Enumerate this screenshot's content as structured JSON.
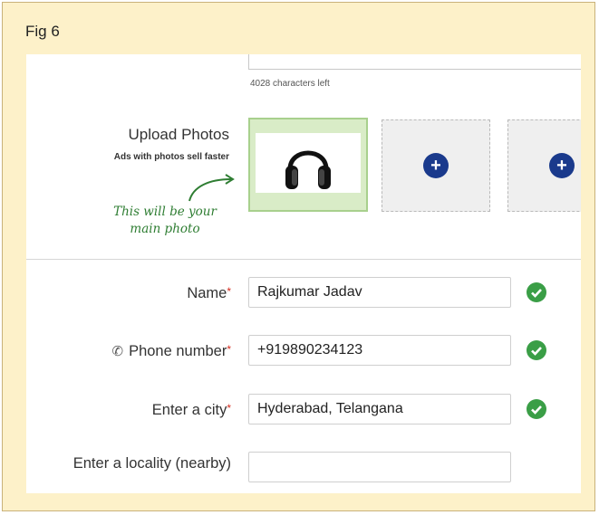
{
  "figure_label": "Fig 6",
  "description_box": {
    "chars_left": "4028 characters left"
  },
  "photos": {
    "title": "Upload Photos",
    "subtitle": "Ads with photos sell faster",
    "hint": "This will be your main photo",
    "main_photo_icon": "headphones-icon",
    "add_icon": "plus-circle-icon"
  },
  "form": {
    "name": {
      "label": "Name",
      "required": "*",
      "value": "Rajkumar Jadav",
      "valid": true
    },
    "phone": {
      "label": "Phone number",
      "required": "*",
      "value": "+919890234123",
      "valid": true,
      "icon": "phone-icon"
    },
    "city": {
      "label": "Enter a city",
      "required": "*",
      "value": "Hyderabad, Telangana",
      "valid": true
    },
    "locality": {
      "label": "Enter a locality (nearby)",
      "value": ""
    }
  },
  "colors": {
    "frame_bg": "#fdf1c9",
    "check_green": "#3a9e46",
    "required_red": "#d52b1e",
    "plus_blue": "#1a3a8c",
    "hint_green": "#2e7d32"
  }
}
